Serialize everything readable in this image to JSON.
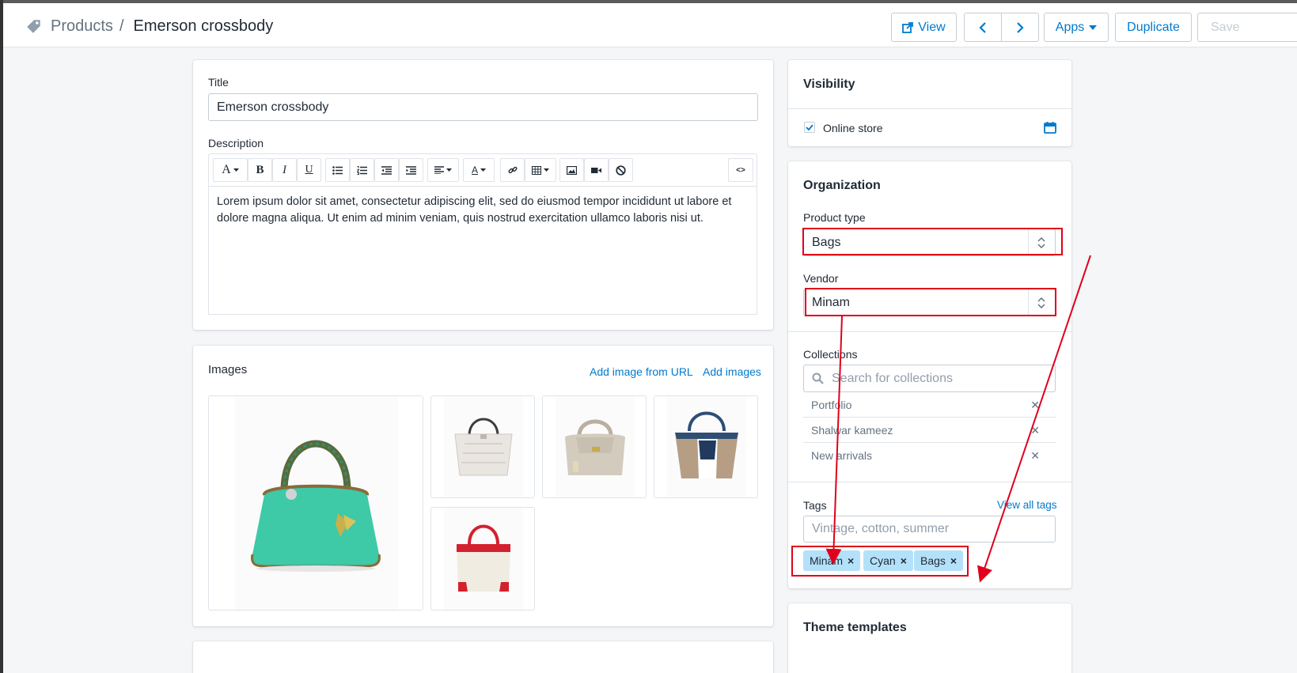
{
  "breadcrumb": {
    "parent": "Products",
    "separator": "/",
    "current": "Emerson crossbody"
  },
  "topbar": {
    "view_label": "View",
    "apps_label": "Apps",
    "duplicate_label": "Duplicate",
    "save_label": "Save"
  },
  "product": {
    "title_label": "Title",
    "title_value": "Emerson crossbody",
    "description_label": "Description",
    "description_text": "Lorem ipsum dolor sit amet, consectetur adipiscing elit, sed do eiusmod tempor incididunt ut labore et dolore magna aliqua. Ut enim ad minim veniam, quis nostrud exercitation ullamco laboris nisi ut.",
    "code_toggle": "<>"
  },
  "images": {
    "title": "Images",
    "add_from_url": "Add image from URL",
    "add_images": "Add images"
  },
  "visibility": {
    "title": "Visibility",
    "online_store_label": "Online store",
    "online_store_checked": true
  },
  "organization": {
    "title": "Organization",
    "product_type_label": "Product type",
    "product_type_value": "Bags",
    "vendor_label": "Vendor",
    "vendor_value": "Minam",
    "collections_label": "Collections",
    "collections_placeholder": "Search for collections",
    "collections": [
      {
        "name": "Portfolio"
      },
      {
        "name": "Shalwar kameez"
      },
      {
        "name": "New arrivals"
      }
    ],
    "tags_label": "Tags",
    "view_all_tags": "View all tags",
    "tags_placeholder": "Vintage, cotton, summer",
    "tags": [
      "Minam",
      "Cyan",
      "Bags"
    ]
  },
  "theme_templates": {
    "title": "Theme templates"
  },
  "colors": {
    "accent": "#007ace",
    "annotation": "#e0001b",
    "chip": "#b4e1fa"
  }
}
